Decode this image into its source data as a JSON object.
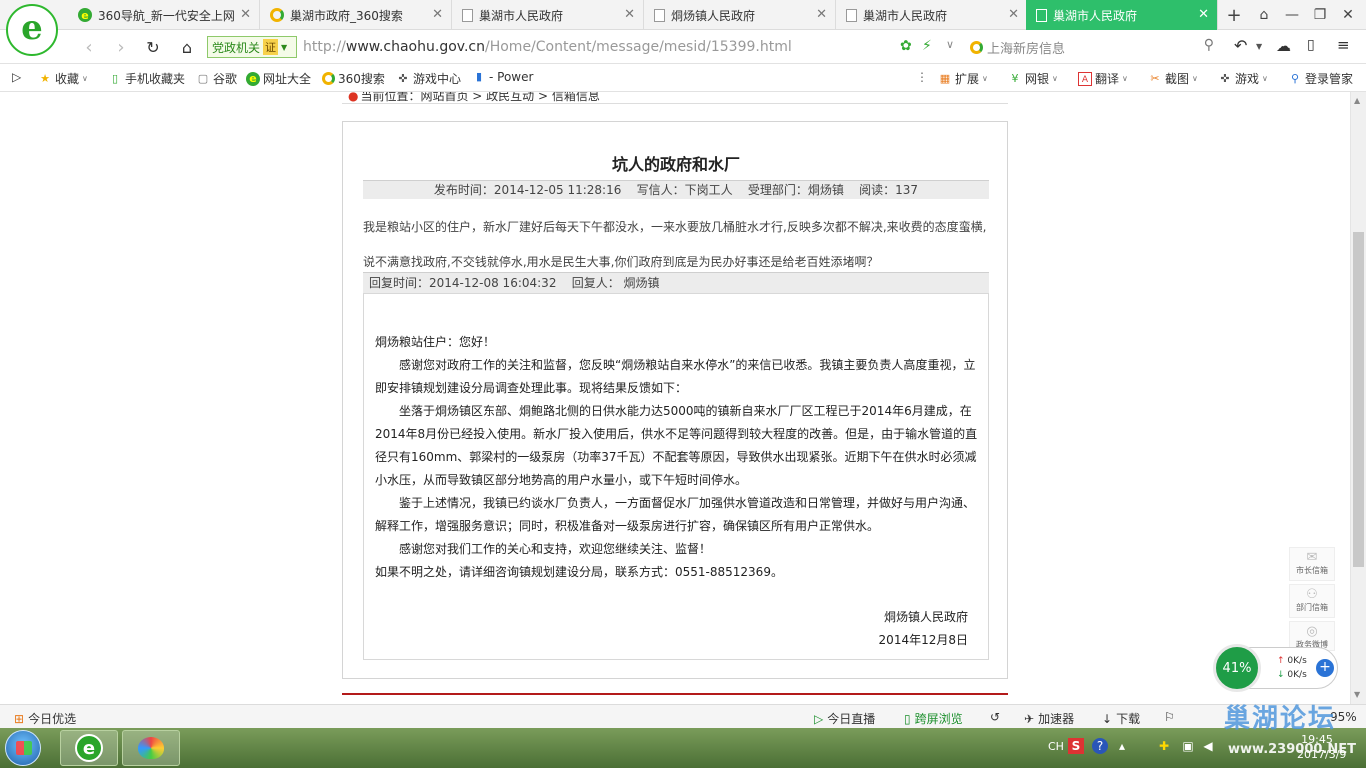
{
  "browser": {
    "tabs": [
      {
        "label": "360导航_新一代安全上网",
        "icon": "360-icon",
        "active": false
      },
      {
        "label": "巢湖市政府_360搜索",
        "icon": "search-ring-icon",
        "active": false
      },
      {
        "label": "巢湖市人民政府",
        "icon": "page-icon",
        "active": false
      },
      {
        "label": "烔炀镇人民政府",
        "icon": "page-icon",
        "active": false
      },
      {
        "label": "巢湖市人民政府",
        "icon": "page-icon",
        "active": false
      },
      {
        "label": "巢湖市人民政府",
        "icon": "page-icon",
        "active": true
      }
    ],
    "gov_badge": "党政机关",
    "gov_cert": "证",
    "url_host": "www.chaohu.gov.cn",
    "url_scheme": "http://",
    "url_path": "/Home/Content/message/mesid/15399.html",
    "search_placeholder": "上海新房信息",
    "bookmarks": [
      {
        "label": "收藏",
        "icon": "star-icon"
      },
      {
        "label": "手机收藏夹",
        "icon": "phone-icon"
      },
      {
        "label": "谷歌",
        "icon": "page-icon"
      },
      {
        "label": "网址大全",
        "icon": "360-icon"
      },
      {
        "label": "360搜索",
        "icon": "search-ring-icon"
      },
      {
        "label": "游戏中心",
        "icon": "gamepad-icon"
      },
      {
        "label": "- Power",
        "icon": "power-icon"
      }
    ],
    "right_tools": [
      {
        "label": "扩展",
        "icon": "extension-icon"
      },
      {
        "label": "网银",
        "icon": "bank-icon"
      },
      {
        "label": "翻译",
        "icon": "translate-icon"
      },
      {
        "label": "截图",
        "icon": "scissors-icon"
      },
      {
        "label": "游戏",
        "icon": "gamepad-icon"
      },
      {
        "label": "登录管家",
        "icon": "key-icon"
      }
    ]
  },
  "page": {
    "breadcrumb": "当前位置：网站首页 > 政民互动 > 信箱信息",
    "title": "坑人的政府和水厂",
    "meta": "发布时间：2014-12-05 11:28:16    写信人：下岗工人    受理部门：烔炀镇    阅读：137",
    "question_lines": [
      "我是粮站小区的住户，新水厂建好后每天下午都没水，一来水要放几桶脏水才行,反映多次都不解决,来收费的态度蛮横,",
      "说不满意找政府,不交钱就停水,用水是民生大事,你们政府到底是为民办好事还是给老百姓添堵啊？"
    ],
    "reply_meta": "回复时间：2014-12-08 16:04:32    回复人： 烔炀镇",
    "reply_paragraphs": [
      {
        "text": "烔炀粮站住户：您好！",
        "indent": false
      },
      {
        "text": "感谢您对政府工作的关注和监督，您反映“烔炀粮站自来水停水”的来信已收悉。我镇主要负责人高度重视，立即安排镇规划建设分局调查处理此事。现将结果反馈如下：",
        "indent": true
      },
      {
        "text": "坐落于烔炀镇区东部、烔鲍路北侧的日供水能力达5000吨的镇新自来水厂厂区工程已于2014年6月建成，在2014年8月份已经投入使用。新水厂投入使用后，供水不足等问题得到较大程度的改善。但是，由于输水管道的直径只有160mm、郭梁村的一级泵房（功率37千瓦）不配套等原因，导致供水出现紧张。近期下午在供水时必须减小水压，从而导致镇区部分地势高的用户水量小，或下午短时间停水。",
        "indent": true
      },
      {
        "text": "鉴于上述情况，我镇已约谈水厂负责人，一方面督促水厂加强供水管道改造和日常管理，并做好与用户沟通、解释工作，增强服务意识；同时，积极准备对一级泵房进行扩容，确保镇区所有用户正常供水。",
        "indent": true
      },
      {
        "text": "感谢您对我们工作的关心和支持，欢迎您继续关注、监督！",
        "indent": true
      },
      {
        "text": "如果不明之处，请详细咨询镇规划建设分局，联系方式：0551-88512369。",
        "indent": false
      }
    ],
    "signature": "烔炀镇人民政府",
    "sign_date": "2014年12月8日"
  },
  "side_widgets": [
    {
      "label": "市长信箱",
      "icon": "mail-icon"
    },
    {
      "label": "部门信箱",
      "icon": "people-icon"
    },
    {
      "label": "政务微博",
      "icon": "weibo-icon"
    }
  ],
  "speed_widget": {
    "percent": "41%",
    "up": "0K/s",
    "down": "0K/s"
  },
  "statusbar": {
    "left": "今日优选",
    "items": [
      {
        "label": "今日直播",
        "icon": "play-icon"
      },
      {
        "label": "跨屏浏览",
        "icon": "phone-icon"
      },
      {
        "label": "",
        "icon": "refresh-icon"
      },
      {
        "label": "加速器",
        "icon": "rocket-icon"
      },
      {
        "label": "下载",
        "icon": "download-icon"
      }
    ],
    "zoom": "95%"
  },
  "taskbar": {
    "lang": "CH",
    "time": "19:45",
    "date": "2017/3/9"
  },
  "watermark": {
    "text": "巢湖论坛",
    "url": "www.239000.NET"
  },
  "colors": {
    "tab_active": "#2ebf6b",
    "gov_green": "#2c8a1c",
    "footer_red": "#b31a1a"
  }
}
